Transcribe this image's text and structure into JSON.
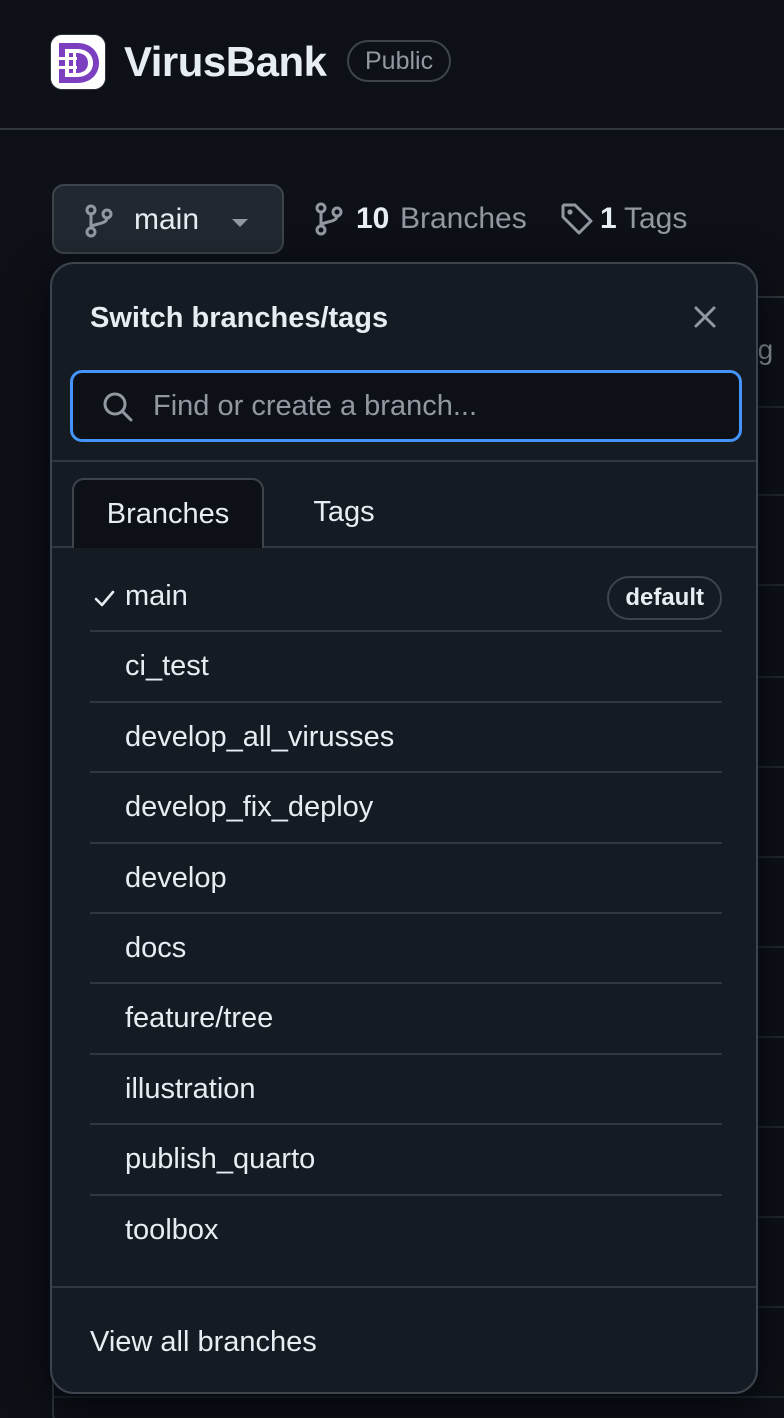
{
  "repo": {
    "name": "VirusBank",
    "visibility": "Public"
  },
  "branch_selector": {
    "current_branch": "main",
    "branch_count": "10",
    "branch_word": "Branches",
    "tag_count": "1",
    "tag_word": "Tags"
  },
  "background_peek_text": "ag",
  "dropdown": {
    "title": "Switch branches/tags",
    "close_icon": "x-icon",
    "search_placeholder": "Find or create a branch...",
    "search_value": "",
    "tabs": [
      {
        "label": "Branches",
        "active": true
      },
      {
        "label": "Tags",
        "active": false
      }
    ],
    "branches": [
      {
        "name": "main",
        "selected": true,
        "badge": "default"
      },
      {
        "name": "ci_test",
        "selected": false
      },
      {
        "name": "develop_all_virusses",
        "selected": false
      },
      {
        "name": "develop_fix_deploy",
        "selected": false
      },
      {
        "name": "develop",
        "selected": false
      },
      {
        "name": "docs",
        "selected": false
      },
      {
        "name": "feature/tree",
        "selected": false
      },
      {
        "name": "illustration",
        "selected": false
      },
      {
        "name": "publish_quarto",
        "selected": false
      },
      {
        "name": "toolbox",
        "selected": false
      }
    ],
    "footer_link": "View all branches"
  },
  "colors": {
    "background": "#0d1117",
    "panel": "#151b23",
    "border": "#3d444d",
    "focus": "#4493f8",
    "muted_text": "#9198a1",
    "logo_accent": "#7b3fbf"
  }
}
